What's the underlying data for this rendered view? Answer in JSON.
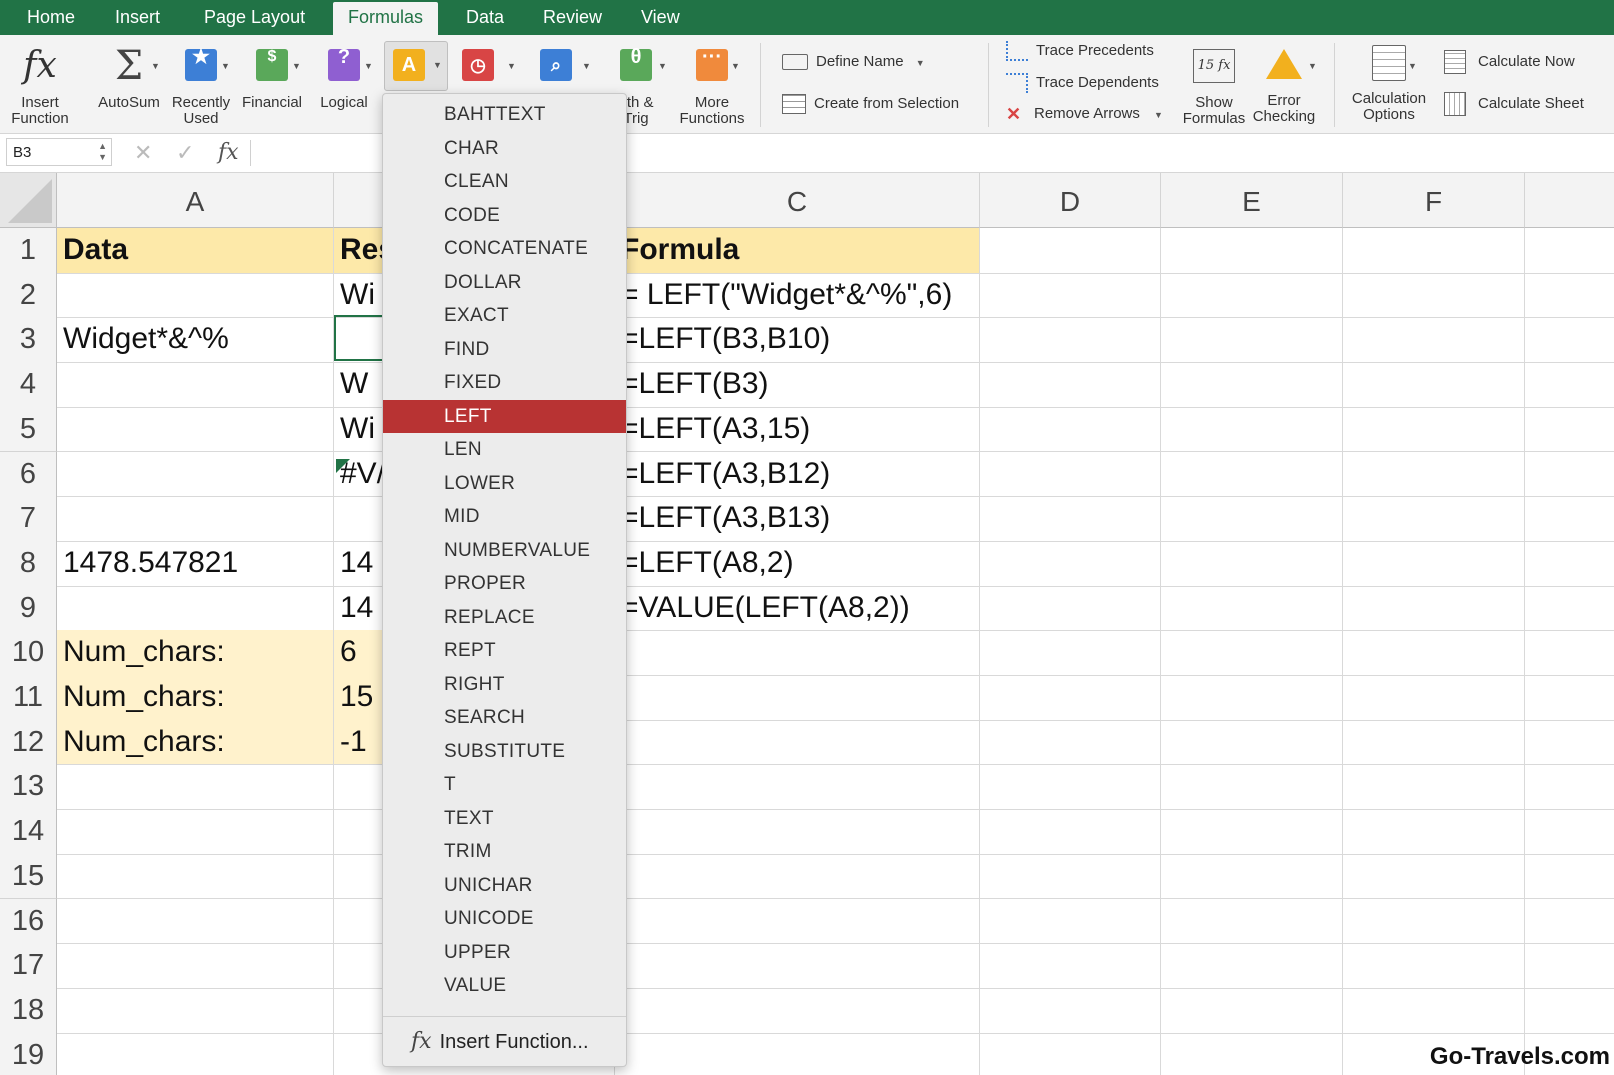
{
  "tabs": {
    "home": "Home",
    "insert": "Insert",
    "page_layout": "Page Layout",
    "formulas": "Formulas",
    "data": "Data",
    "review": "Review",
    "view": "View"
  },
  "ribbon": {
    "insert_function": [
      "Insert",
      "Function"
    ],
    "autosum": "AutoSum",
    "recently_used": [
      "Recently",
      "Used"
    ],
    "financial": "Financial",
    "logical": "Logical",
    "math_trig": [
      "ath &",
      "Trig"
    ],
    "more_functions": [
      "More",
      "Functions"
    ],
    "define_name": "Define Name",
    "create_from_selection": "Create from Selection",
    "trace_precedents": "Trace Precedents",
    "trace_dependents": "Trace Dependents",
    "remove_arrows": "Remove Arrows",
    "show_formulas": [
      "Show",
      "Formulas"
    ],
    "error_checking": [
      "Error",
      "Checking"
    ],
    "calculation_options": [
      "Calculation",
      "Options"
    ],
    "calculate_now": "Calculate Now",
    "calculate_sheet": "Calculate Sheet"
  },
  "formula_bar": {
    "name_box": "B3",
    "cancel_glyph": "✕",
    "enter_glyph": "✓",
    "fx_glyph": "fx",
    "content": ""
  },
  "columns": [
    "A",
    "",
    "C",
    "D",
    "E",
    "F",
    ""
  ],
  "rows": [
    "1",
    "2",
    "3",
    "4",
    "5",
    "6",
    "7",
    "8",
    "9",
    "10",
    "11",
    "12",
    "13",
    "14",
    "15",
    "16",
    "17",
    "18",
    "19"
  ],
  "cells": {
    "A1": "Data",
    "B1": "Res",
    "C1": "Formula",
    "B2": "Wi",
    "C2": "= LEFT(\"Widget*&^%\",6)",
    "A3": "Widget*&^%",
    "C3": "=LEFT(B3,B10)",
    "B4": "W",
    "C4": "=LEFT(B3)",
    "B5": "Wi",
    "C5": "=LEFT(A3,15)",
    "B6": "#V/",
    "C6": "=LEFT(A3,B12)",
    "C7": "=LEFT(A3,B13)",
    "A8": "1478.547821",
    "B8": "14",
    "C8": "=LEFT(A8,2)",
    "B9": "14",
    "C9": "=VALUE(LEFT(A8,2))",
    "A10": "Num_chars:",
    "B10": "6",
    "A11": "Num_chars:",
    "B11": "15",
    "A12": "Num_chars:",
    "B12": "-1"
  },
  "dropdown": {
    "items": [
      "BAHTTEXT",
      "CHAR",
      "CLEAN",
      "CODE",
      "CONCATENATE",
      "DOLLAR",
      "EXACT",
      "FIND",
      "FIXED",
      "LEFT",
      "LEN",
      "LOWER",
      "MID",
      "NUMBERVALUE",
      "PROPER",
      "REPLACE",
      "REPT",
      "RIGHT",
      "SEARCH",
      "SUBSTITUTE",
      "T",
      "TEXT",
      "TRIM",
      "UNICHAR",
      "UNICODE",
      "UPPER",
      "VALUE"
    ],
    "selected": "LEFT",
    "insert_function": "Insert Function...",
    "highlight_color": "#b83333"
  },
  "colors": {
    "accent": "#217346",
    "header_fill": "#fde9a9",
    "label_fill": "#fff2cc"
  },
  "watermark": "Go-Travels.com"
}
